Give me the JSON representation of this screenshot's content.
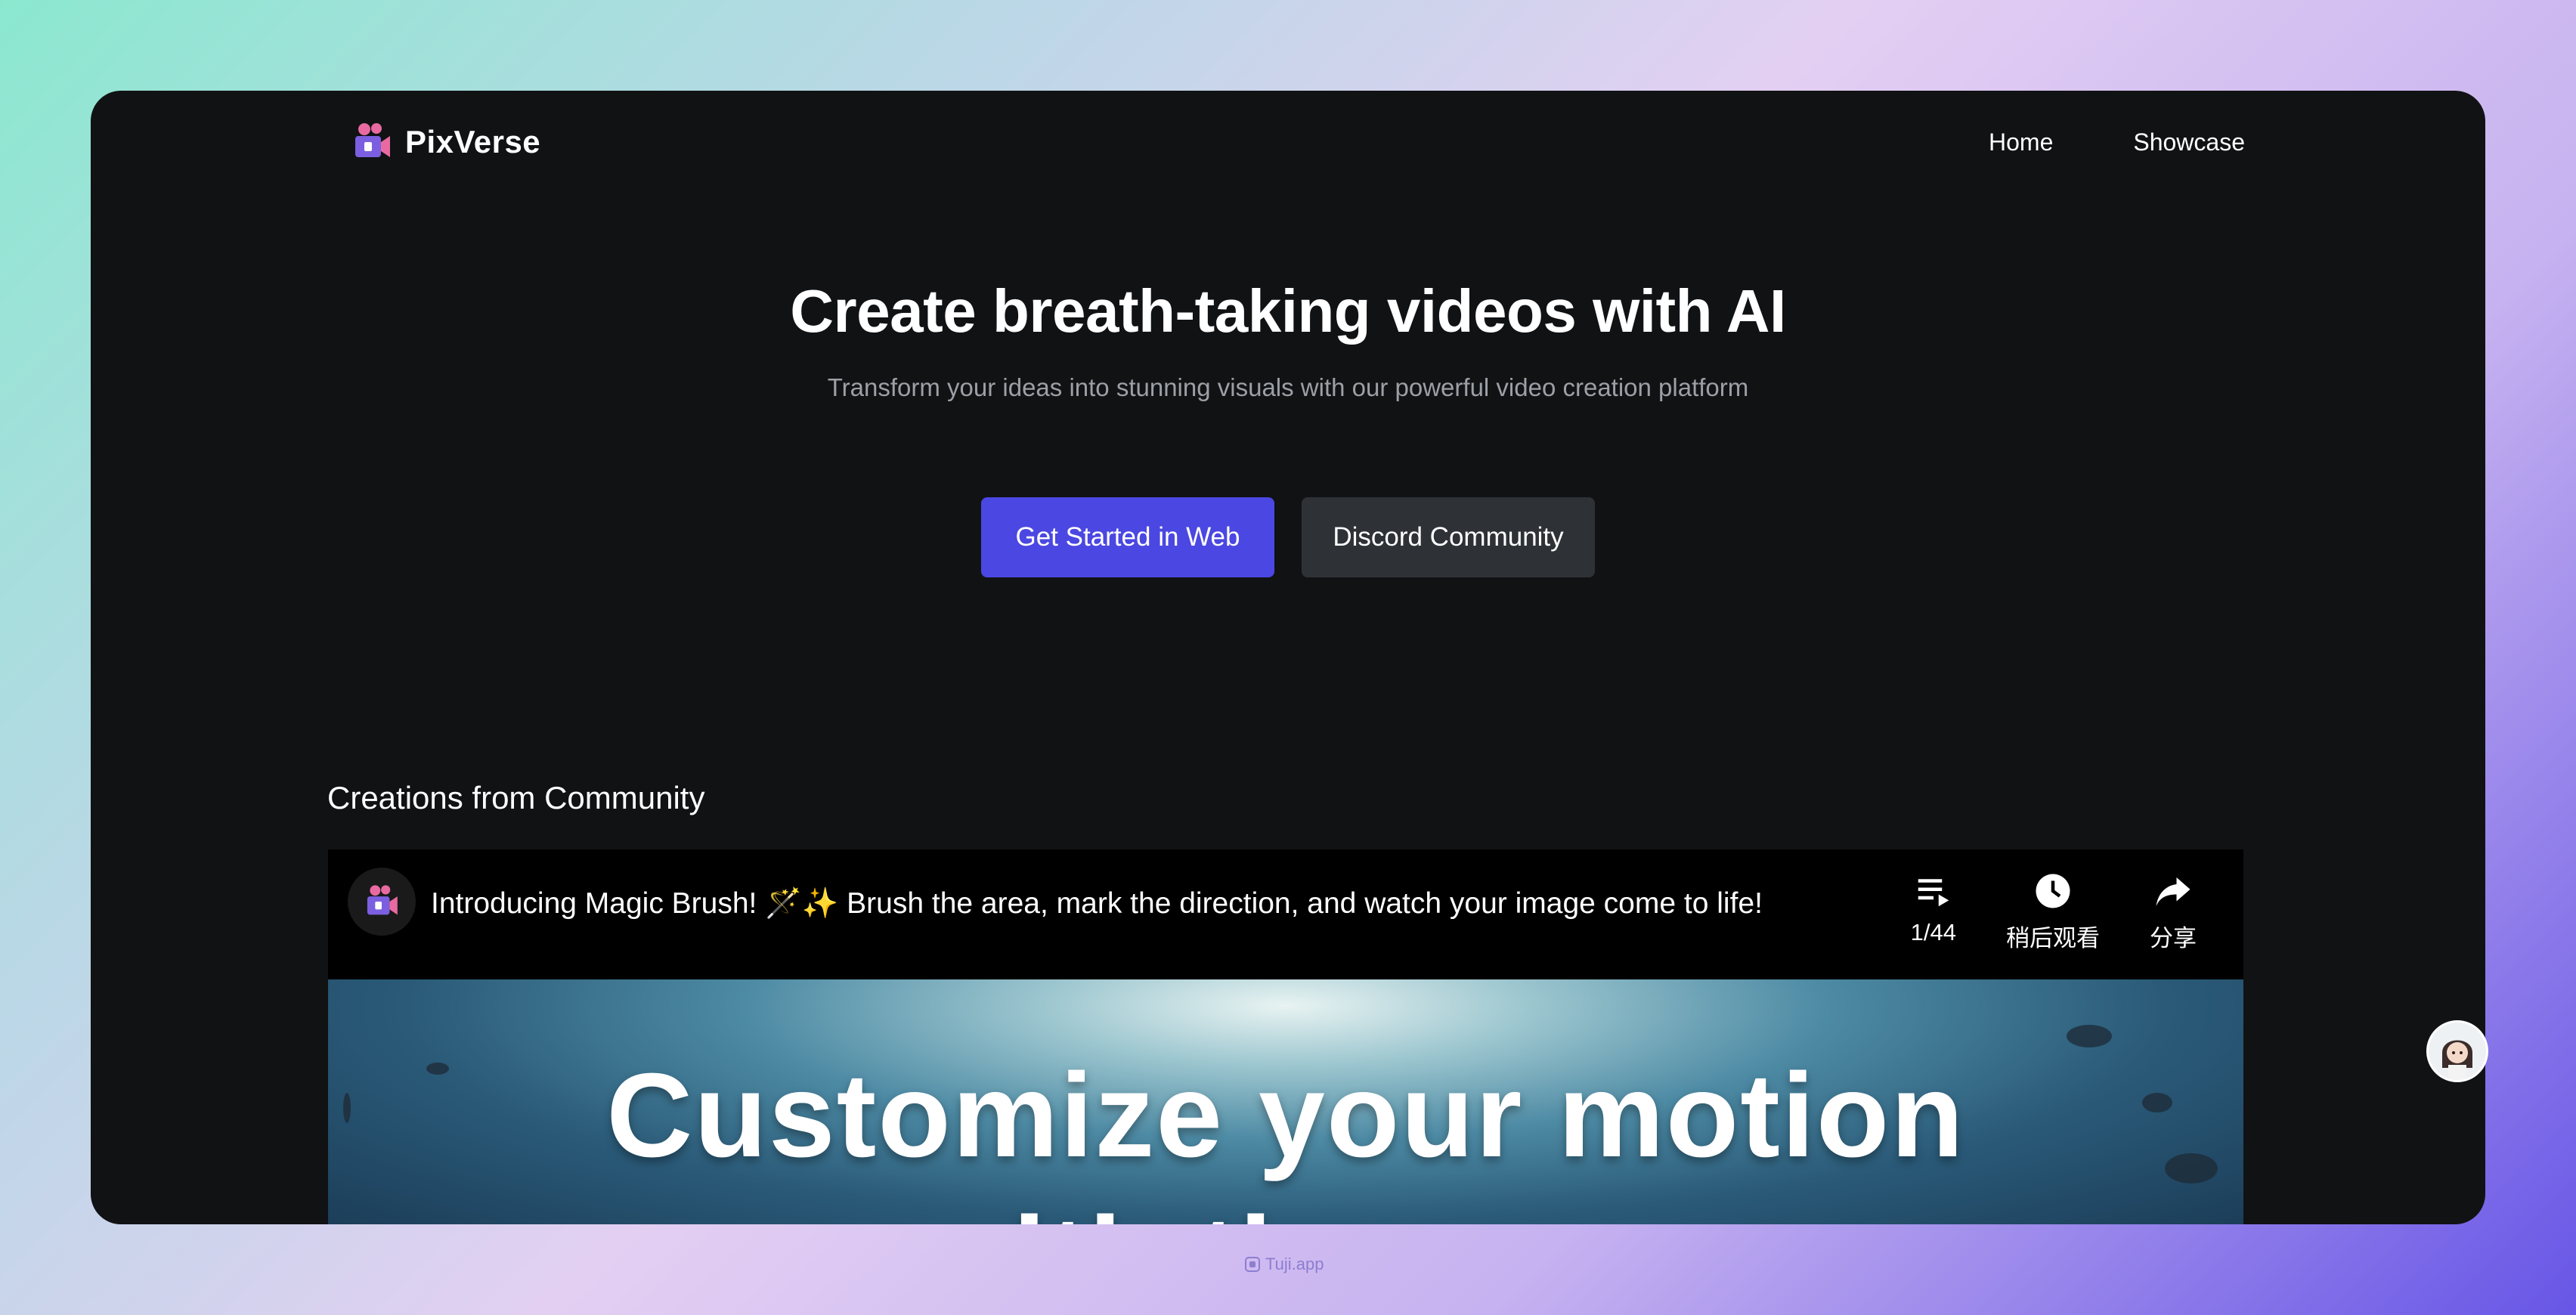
{
  "colors": {
    "accent": "#4b47e2",
    "secondary_button": "#2e3136",
    "background": "#111214",
    "logo_pink": "#e86aa1",
    "logo_purple": "#7b5fe0"
  },
  "brand": {
    "name": "PixVerse",
    "logo_icon": "video-camera-icon"
  },
  "nav": {
    "items": [
      {
        "label": "Home"
      },
      {
        "label": "Showcase"
      }
    ]
  },
  "hero": {
    "title": "Create breath-taking videos with AI",
    "subtitle": "Transform your ideas into stunning visuals with our powerful video creation platform",
    "primary_button": "Get Started in Web",
    "secondary_button": "Discord Community"
  },
  "community": {
    "section_title": "Creations from Community",
    "video": {
      "title": "Introducing Magic Brush! 🪄✨ Brush the area, mark the direction, and watch your image come to life!",
      "actions": [
        {
          "icon": "playlist-icon",
          "label": "1/44"
        },
        {
          "icon": "clock-icon",
          "label": "稍后观看"
        },
        {
          "icon": "share-icon",
          "label": "分享"
        }
      ],
      "frame_text_line1": "Customize your motion",
      "frame_text_line2": "with the new"
    }
  },
  "watermark": {
    "text": "Tuji.app"
  }
}
